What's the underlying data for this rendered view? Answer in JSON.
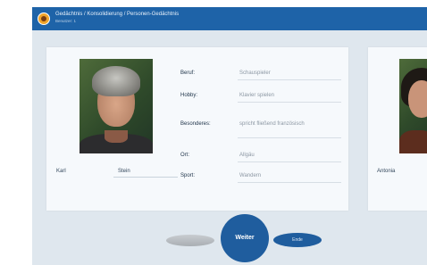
{
  "header": {
    "breadcrumb": "Gedächtnis / Konsolidierung / Personen-Gedächtnis",
    "subtitle": "Benutzer: 1"
  },
  "card_main": {
    "first_name": "Karl",
    "last_name": "Stein",
    "fields": [
      {
        "label": "Beruf:",
        "value": "Schauspieler"
      },
      {
        "label": "Hobby:",
        "value": "Klavier spielen"
      },
      {
        "label": "Besonderes:",
        "value": "spricht fließend französisch"
      },
      {
        "label": "Ort:",
        "value": "Allgäu"
      },
      {
        "label": "Sport:",
        "value": "Wandern"
      }
    ]
  },
  "card_next": {
    "first_name": "Antonia"
  },
  "buttons": {
    "weiter": "Weiter",
    "ende": "Ende"
  },
  "colors": {
    "titlebar": "#1e63a8",
    "accent": "#1f5d9e",
    "background": "#dfe7ee"
  }
}
